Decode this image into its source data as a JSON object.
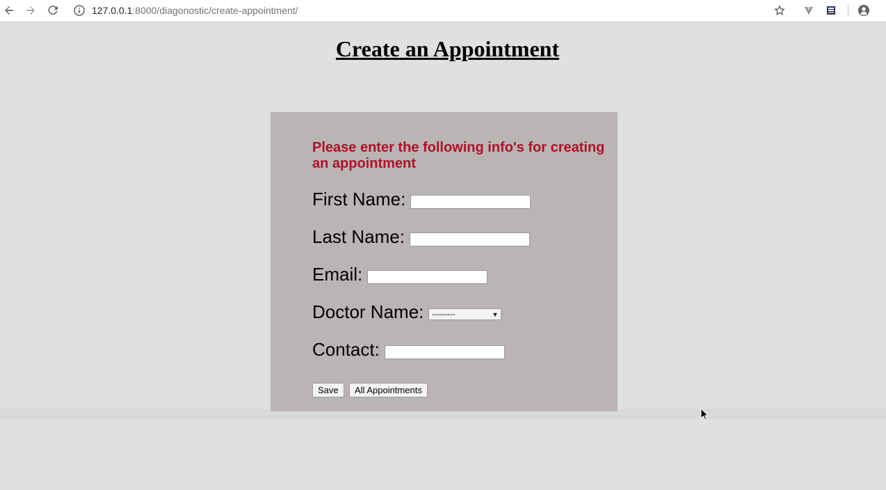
{
  "browser": {
    "url_host": "127.0.0.1",
    "url_path": ":8000/diagonostic/create-appointment/"
  },
  "page": {
    "title": "Create an Appointment",
    "intro": "Please enter the following info's for creating an appointment"
  },
  "form": {
    "first_name_label": "First Name:",
    "first_name_value": "",
    "last_name_label": "Last Name:",
    "last_name_value": "",
    "email_label": "Email:",
    "email_value": "",
    "doctor_label": "Doctor Name:",
    "doctor_selected": "---------",
    "contact_label": "Contact:",
    "contact_value": "",
    "save_label": "Save",
    "all_appointments_label": "All Appointments"
  },
  "colors": {
    "page_bg": "#dfe0e0",
    "card_bg": "#bab5b4",
    "intro_text": "#b0102a"
  },
  "icons": [
    "back-arrow-icon",
    "forward-arrow-icon",
    "reload-icon",
    "info-icon",
    "bookmark-star-icon",
    "extension-icon",
    "extension-icon-2",
    "account-icon",
    "mouse-cursor-icon"
  ]
}
